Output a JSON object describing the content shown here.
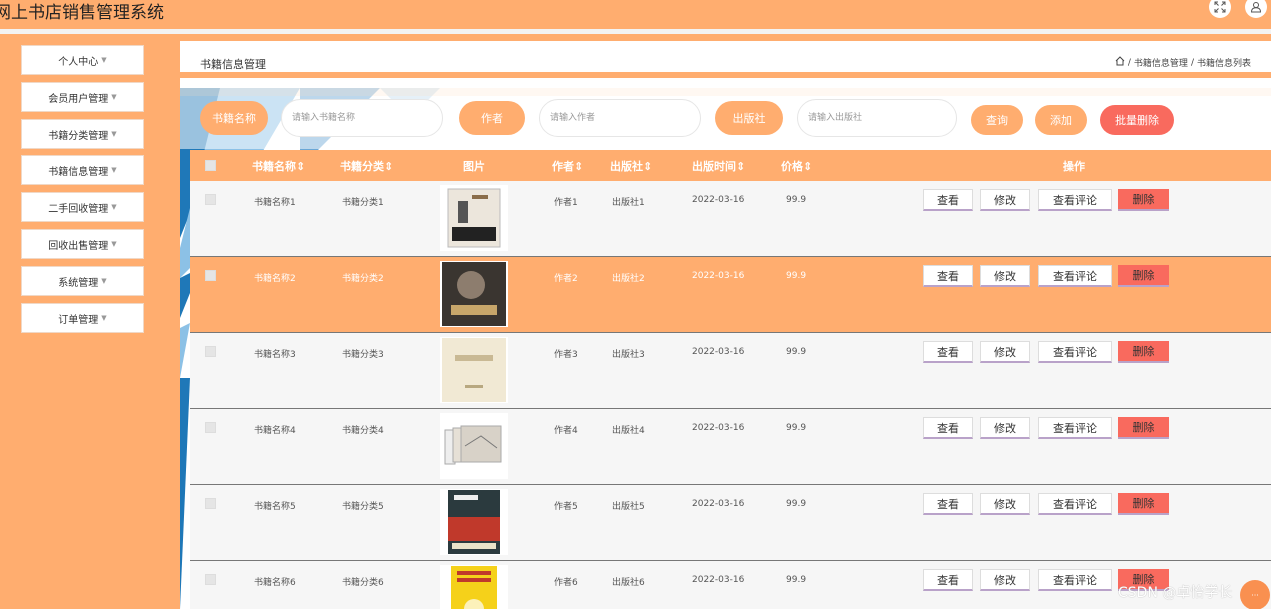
{
  "app": {
    "title": "网上书店销售管理系统"
  },
  "topbar_icons": [
    "fullscreen-icon",
    "user-icon"
  ],
  "sidebar": {
    "items": [
      {
        "label": "个人中心"
      },
      {
        "label": "会员用户管理"
      },
      {
        "label": "书籍分类管理"
      },
      {
        "label": "书籍信息管理"
      },
      {
        "label": "二手回收管理"
      },
      {
        "label": "回收出售管理"
      },
      {
        "label": "系统管理"
      },
      {
        "label": "订单管理"
      }
    ]
  },
  "header": {
    "title": "书籍信息管理",
    "breadcrumb": {
      "sep": "/",
      "level1": "书籍信息管理",
      "level2": "书籍信息列表"
    }
  },
  "search": {
    "name_label": "书籍名称",
    "name_placeholder": "请输入书籍名称",
    "author_label": "作者",
    "author_placeholder": "请输入作者",
    "publisher_label": "出版社",
    "publisher_placeholder": "请输入出版社",
    "query_button": "查询",
    "add_button": "添加",
    "batch_delete_button": "批量删除"
  },
  "table": {
    "columns": {
      "name": "书籍名称",
      "category": "书籍分类",
      "image": "图片",
      "author": "作者",
      "publisher": "出版社",
      "pub_date": "出版时间",
      "price": "价格",
      "actions": "操作"
    },
    "actions": {
      "view": "查看",
      "edit": "修改",
      "comments": "查看评论",
      "delete": "删除"
    },
    "rows": [
      {
        "name": "书籍名称1",
        "category": "书籍分类1",
        "author": "作者1",
        "publisher": "出版社1",
        "pub_date": "2022-03-16",
        "price": "99.9",
        "cover_color": "#e9e4da"
      },
      {
        "name": "书籍名称2",
        "category": "书籍分类2",
        "author": "作者2",
        "publisher": "出版社2",
        "pub_date": "2022-03-16",
        "price": "99.9",
        "cover_color": "#3a3530"
      },
      {
        "name": "书籍名称3",
        "category": "书籍分类3",
        "author": "作者3",
        "publisher": "出版社3",
        "pub_date": "2022-03-16",
        "price": "99.9",
        "cover_color": "#f1e9d4"
      },
      {
        "name": "书籍名称4",
        "category": "书籍分类4",
        "author": "作者4",
        "publisher": "出版社4",
        "pub_date": "2022-03-16",
        "price": "99.9",
        "cover_color": "#dcd6cc"
      },
      {
        "name": "书籍名称5",
        "category": "书籍分类5",
        "author": "作者5",
        "publisher": "出版社5",
        "pub_date": "2022-03-16",
        "price": "99.9",
        "cover_color": "#2b3a3e"
      },
      {
        "name": "书籍名称6",
        "category": "书籍分类6",
        "author": "作者6",
        "publisher": "出版社6",
        "pub_date": "2022-03-16",
        "price": "99.9",
        "cover_color": "#f5d11a"
      }
    ]
  },
  "watermark": "CSDN @卓怡学长",
  "colors": {
    "accent": "#ffad6f",
    "danger": "#f96a5e",
    "row_bg": "#f6f6f6"
  }
}
